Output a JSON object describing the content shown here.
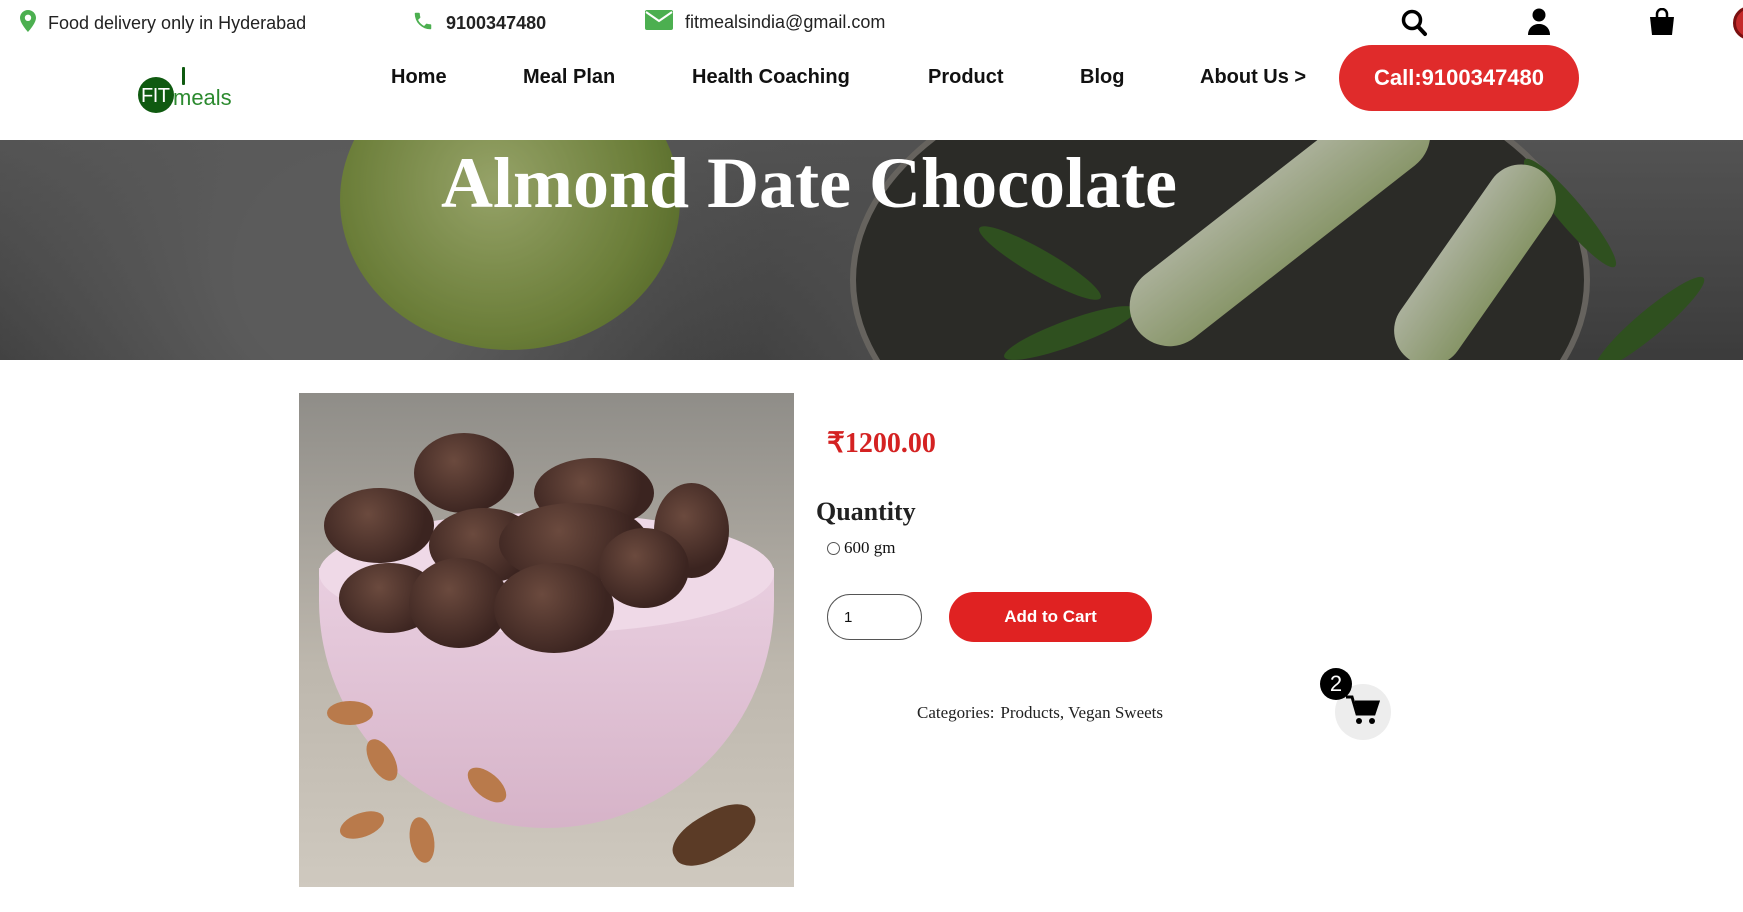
{
  "topbar": {
    "location_text": "Food delivery only in Hyderabad",
    "phone": "9100347480",
    "email": "fitmealsindia@gmail.com"
  },
  "brand": {
    "logo_part1": "FIT",
    "logo_part2": "meals"
  },
  "nav": {
    "items": [
      "Home",
      "Meal Plan",
      "Health Coaching",
      "Product",
      "Blog",
      "About Us >"
    ],
    "call_button": "Call:9100347480"
  },
  "hero": {
    "title": "Almond Date Chocolate"
  },
  "product": {
    "price": "₹1200.00",
    "quantity_label": "Quantity",
    "option": "600 gm",
    "qty_value": "1",
    "add_to_cart": "Add to Cart",
    "categories_label": "Categories:",
    "categories_value": "Products, Vegan Sweets"
  },
  "cart": {
    "count": "2"
  },
  "colors": {
    "accent_red": "#e02b2b",
    "price_red": "#d42222",
    "icon_green": "#4caf50",
    "logo_green": "#0f5a10"
  },
  "icons": [
    "map-pin-icon",
    "phone-icon",
    "mail-icon",
    "search-icon",
    "user-icon",
    "bag-icon",
    "cart-icon"
  ]
}
